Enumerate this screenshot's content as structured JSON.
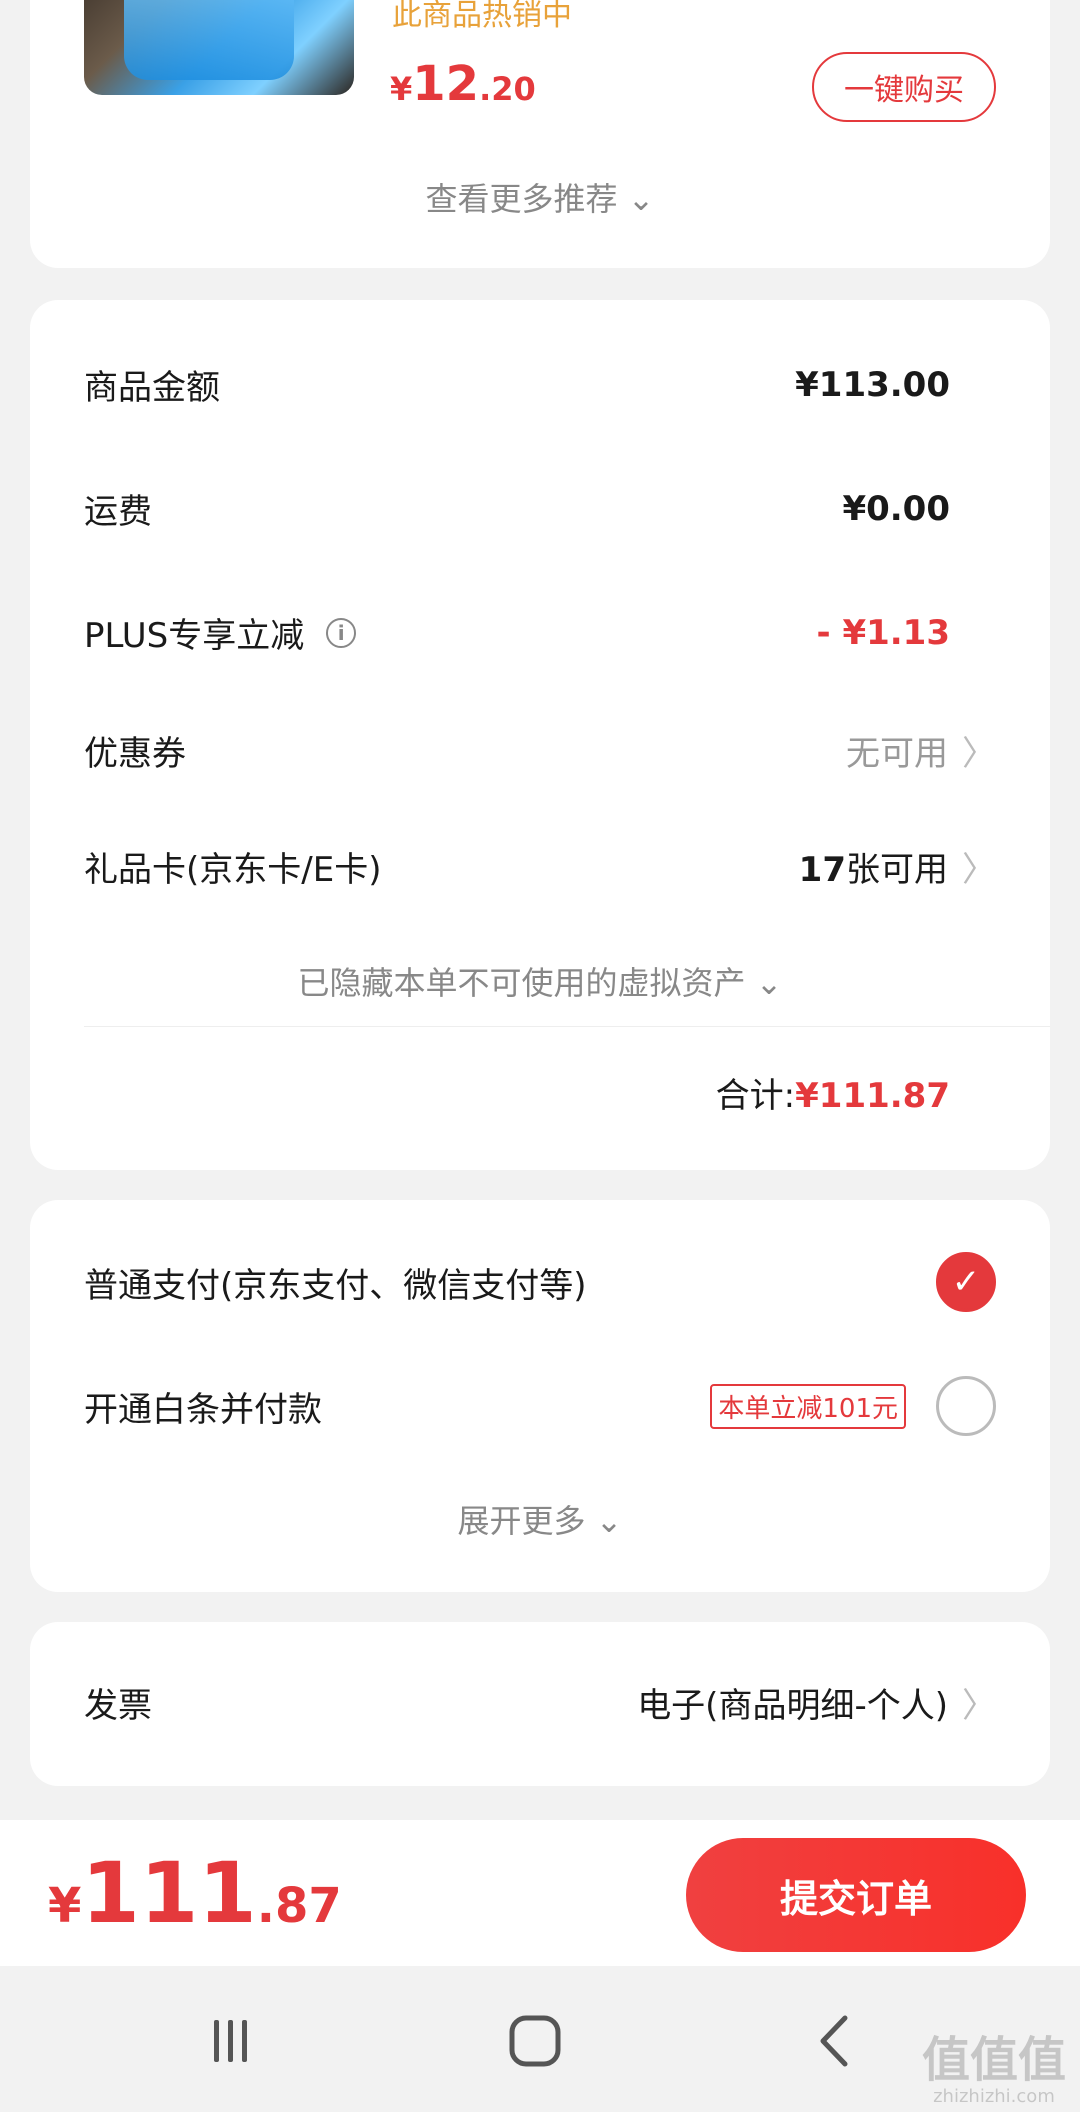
{
  "recommend": {
    "hot_text": "此商品热销中",
    "price_currency": "¥",
    "price_int": "12",
    "price_dec": ".20",
    "buy_label": "一键购买",
    "more_label": "查看更多推荐 ⌄"
  },
  "amounts": {
    "goods_label": "商品金额",
    "goods_value": "¥113.00",
    "shipping_label": "运费",
    "shipping_value": "¥0.00",
    "plus_label": "PLUS专享立减",
    "plus_value": "- ¥1.13",
    "coupon_label": "优惠券",
    "coupon_value": "无可用",
    "giftcard_label": "礼品卡(京东卡/E卡)",
    "giftcard_count": "17",
    "giftcard_suffix": "张可用",
    "hidden_assets": "已隐藏本单不可使用的虚拟资产 ⌄",
    "total_label": "合计:",
    "total_value": "¥111.87"
  },
  "payment": {
    "normal_label": "普通支付(京东支付、微信支付等)",
    "baitiao_label": "开通白条并付款",
    "baitiao_promo": "本单立减101元",
    "expand_more": "展开更多 ⌄"
  },
  "invoice": {
    "label": "发票",
    "value": "电子(商品明细-个人)"
  },
  "bottom": {
    "price_currency": "¥",
    "price_int": "111",
    "price_dec": ".87",
    "submit_label": "提交订单"
  },
  "watermark": {
    "main": "值值值",
    "sub": "zhizhizhi.com"
  },
  "colors": {
    "accent_red": "#e4393c",
    "hot_orange": "#e8a23a"
  },
  "icons": [
    "info-icon",
    "chevron-right-icon",
    "chevron-down-icon",
    "check-icon",
    "recent-apps-icon",
    "home-icon",
    "back-icon"
  ]
}
